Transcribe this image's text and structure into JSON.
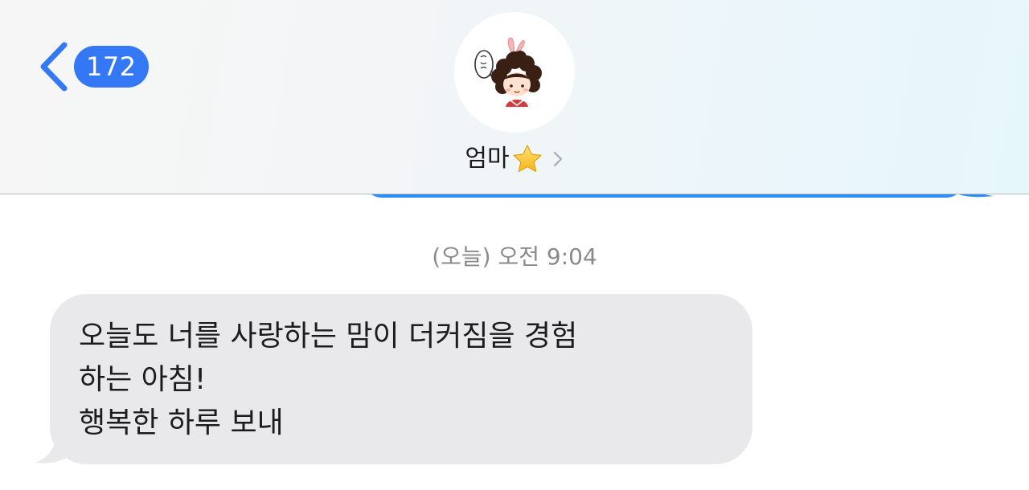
{
  "header": {
    "back_count": "172",
    "contact_name": "엄마",
    "contact_emoji": "star-icon",
    "avatar_icon": "character-avatar-icon"
  },
  "colors": {
    "accent": "#3478f6",
    "outgoing_bubble": "#2b8ef4",
    "incoming_bubble": "#e9e9eb",
    "timestamp_text": "#8a8a8e"
  },
  "conversation": {
    "timestamp": "(오늘) 오전 9:04",
    "messages": [
      {
        "direction": "incoming",
        "lines": [
          "오늘도 너를 사랑하는 맘이 더커짐을 경험",
          "하는 아침!",
          "행복한 하루 보내"
        ]
      }
    ]
  }
}
